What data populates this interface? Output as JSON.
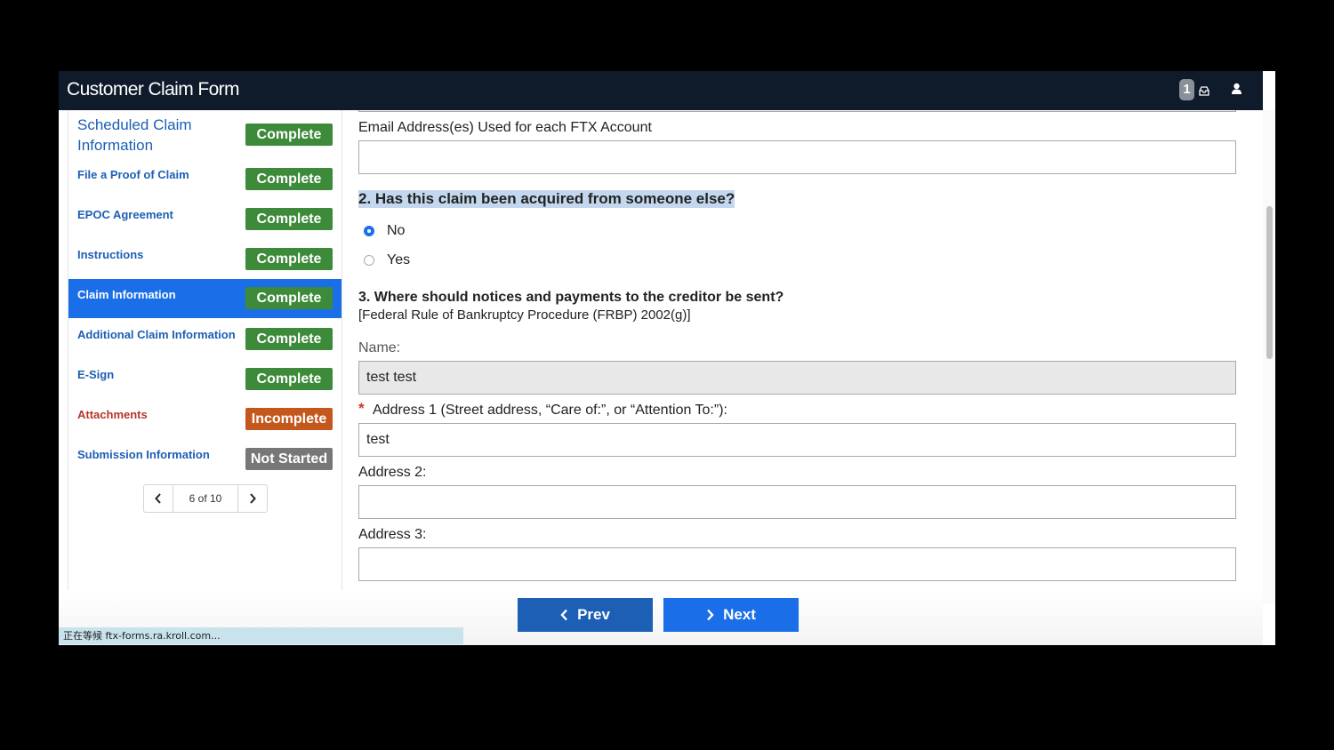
{
  "header": {
    "title": "Customer Claim Form",
    "notification_count": "1"
  },
  "sidebar": {
    "items": [
      {
        "label": "Scheduled Claim Information",
        "status": "Complete"
      },
      {
        "label": "File a Proof of Claim",
        "status": "Complete"
      },
      {
        "label": "EPOC Agreement",
        "status": "Complete"
      },
      {
        "label": "Instructions",
        "status": "Complete"
      },
      {
        "label": "Claim Information",
        "status": "Complete",
        "active": true
      },
      {
        "label": "Additional Claim Information",
        "status": "Complete"
      },
      {
        "label": "E-Sign",
        "status": "Complete"
      },
      {
        "label": "Attachments",
        "status": "Incomplete"
      },
      {
        "label": "Submission Information",
        "status": "Not Started"
      }
    ],
    "pager": {
      "text": "6 of 10"
    }
  },
  "colors": {
    "complete": "#3d8a3a",
    "incomplete": "#c4571c",
    "not_started": "#777777",
    "accent": "#1a6fe8"
  },
  "form": {
    "email_label": "Email Address(es) Used for each FTX Account",
    "email_value": "",
    "q2_title": "2. Has this claim been acquired from someone else?",
    "q2_options": [
      {
        "label": "No",
        "checked": true
      },
      {
        "label": "Yes",
        "checked": false
      }
    ],
    "q3_title": "3. Where should notices and payments to the creditor be sent?",
    "q3_subtitle": "[Federal Rule of Bankruptcy Procedure (FRBP) 2002(g)]",
    "name_label": "Name:",
    "name_value": "test test",
    "address1_label": "Address 1 (Street address, “Care of:”, or “Attention To:”):",
    "address1_value": "test",
    "address2_label": "Address 2:",
    "address2_value": "",
    "address3_label": "Address 3:",
    "address3_value": ""
  },
  "footer": {
    "prev_label": "Prev",
    "next_label": "Next"
  },
  "status_bar": {
    "text": "正在等候 ftx-forms.ra.kroll.com..."
  }
}
